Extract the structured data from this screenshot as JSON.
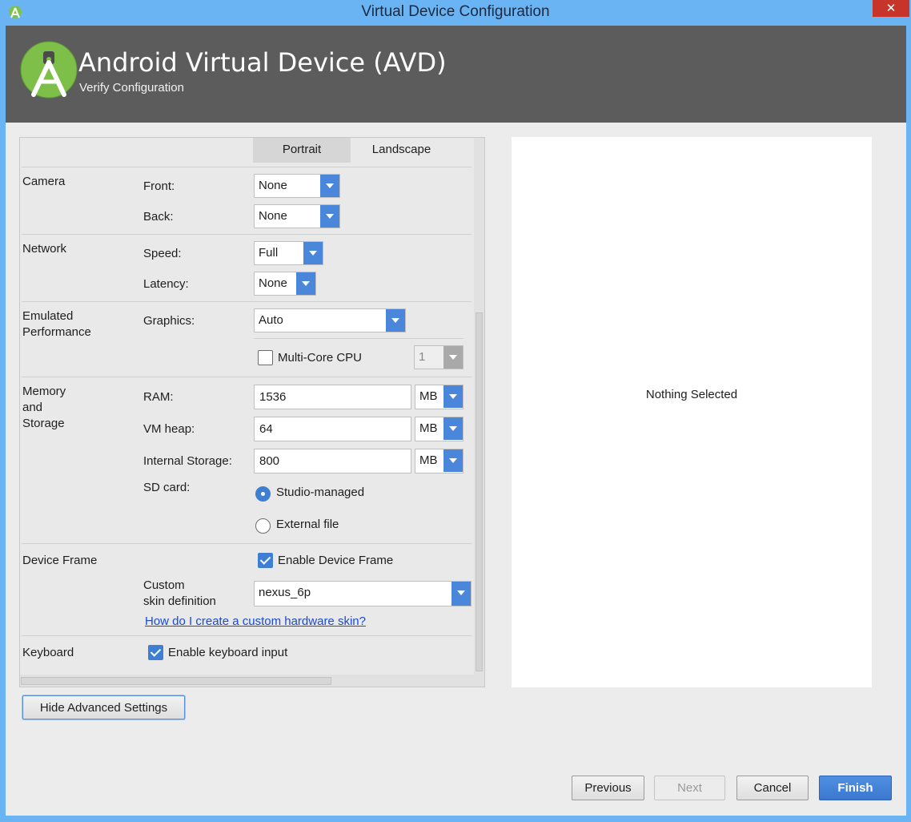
{
  "window": {
    "title": "Virtual Device Configuration",
    "close_glyph": "✕"
  },
  "header": {
    "title": "Android Virtual Device (AVD)",
    "subtitle": "Verify Configuration",
    "logo_icon": "android-studio-logo-icon",
    "bg_color": "#5c5c5c"
  },
  "tabs": {
    "portrait": "Portrait",
    "landscape": "Landscape"
  },
  "camera": {
    "section": "Camera",
    "front_label": "Front:",
    "front_value": "None",
    "back_label": "Back:",
    "back_value": "None"
  },
  "network": {
    "section": "Network",
    "speed_label": "Speed:",
    "speed_value": "Full",
    "latency_label": "Latency:",
    "latency_value": "None"
  },
  "performance": {
    "section_line1": "Emulated",
    "section_line2": "Performance",
    "graphics_label": "Graphics:",
    "graphics_value": "Auto",
    "multicore_label": "Multi-Core CPU",
    "multicore_checked": false,
    "cores_value": "1"
  },
  "memory": {
    "section_line1": "Memory",
    "section_line2": "and",
    "section_line3": "Storage",
    "ram_label": "RAM:",
    "ram_value": "1536",
    "ram_unit": "MB",
    "vmheap_label": "VM heap:",
    "vmheap_value": "64",
    "vmheap_unit": "MB",
    "internal_label": "Internal Storage:",
    "internal_value": "800",
    "internal_unit": "MB",
    "sdcard_label": "SD card:",
    "sd_studio": "Studio-managed",
    "sd_external": "External file",
    "sd_selected": "studio-managed"
  },
  "device_frame": {
    "section": "Device Frame",
    "enable_label": "Enable Device Frame",
    "enable_checked": true,
    "custom_line1": "Custom",
    "custom_line2": "skin definition",
    "skin_value": "nexus_6p",
    "help_link": "How do I create a custom hardware skin?"
  },
  "keyboard": {
    "section": "Keyboard",
    "enable_label": "Enable keyboard input",
    "enable_checked": true
  },
  "preview": {
    "empty_text": "Nothing Selected"
  },
  "buttons": {
    "hide_advanced": "Hide Advanced Settings",
    "previous": "Previous",
    "next": "Next",
    "cancel": "Cancel",
    "finish": "Finish"
  },
  "colors": {
    "accent": "#4a86d9",
    "link": "#1a4bd6",
    "title_bar": "#6ab4f4",
    "close_button": "#c7342a"
  }
}
